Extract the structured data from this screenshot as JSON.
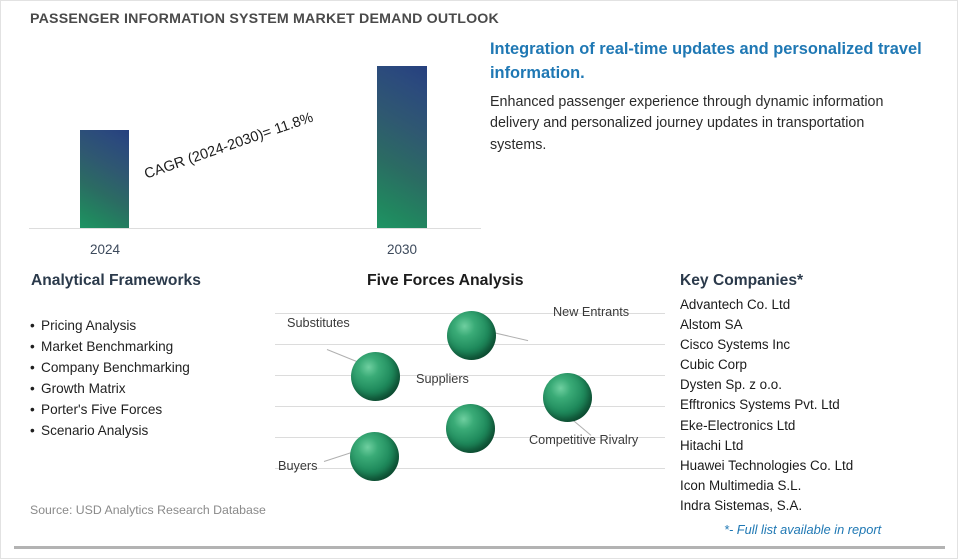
{
  "title": "PASSENGER INFORMATION SYSTEM MARKET DEMAND OUTLOOK",
  "headline": {
    "title": "Integration of real-time updates and personalized travel information.",
    "body": "Enhanced passenger experience through dynamic information delivery and personalized journey updates in transportation systems."
  },
  "chart_data": {
    "type": "bar",
    "title": "",
    "categories": [
      "2024",
      "2030"
    ],
    "values": [
      98,
      162
    ],
    "value_unit": "relative bar height (no axis labels shown)",
    "xlabel": "",
    "ylabel": "",
    "grid": false,
    "annotation": "CAGR (2024-2030)=  11.8%",
    "cagr_percent": "11.8%",
    "cagr_period": "2024-2030",
    "bar_gradient": {
      "from": "#1e9464",
      "to": "#26407f",
      "direction": "bottom-left green to top-right navy"
    }
  },
  "frameworks": {
    "heading": "Analytical Frameworks",
    "items": [
      "Pricing Analysis",
      "Market Benchmarking",
      "Company Benchmarking",
      "Growth Matrix",
      "Porter's Five Forces",
      "Scenario Analysis"
    ]
  },
  "five_forces": {
    "heading": "Five Forces Analysis",
    "nodes": [
      {
        "label": "New Entrants"
      },
      {
        "label": "Substitutes"
      },
      {
        "label": "Suppliers"
      },
      {
        "label": "Competitive Rivalry"
      },
      {
        "label": "Buyers"
      }
    ]
  },
  "companies": {
    "heading": "Key Companies*",
    "items": [
      "Advantech Co. Ltd",
      "Alstom SA",
      "Cisco Systems Inc",
      "Cubic Corp",
      "Dysten Sp. z o.o.",
      "Efftronics Systems Pvt. Ltd",
      "Eke-Electronics Ltd",
      "Hitachi Ltd",
      "Huawei Technologies Co. Ltd",
      "Icon Multimedia S.L.",
      "Indra Sistemas, S.A."
    ],
    "footnote": "*- Full list available in report"
  },
  "source": "Source: USD Analytics Research Database",
  "colors": {
    "accent_blue": "#1f78b4",
    "heading_slate": "#2b3a4b",
    "title_gray": "#4a4a4a",
    "sphere_green": "#1f8a5c"
  }
}
